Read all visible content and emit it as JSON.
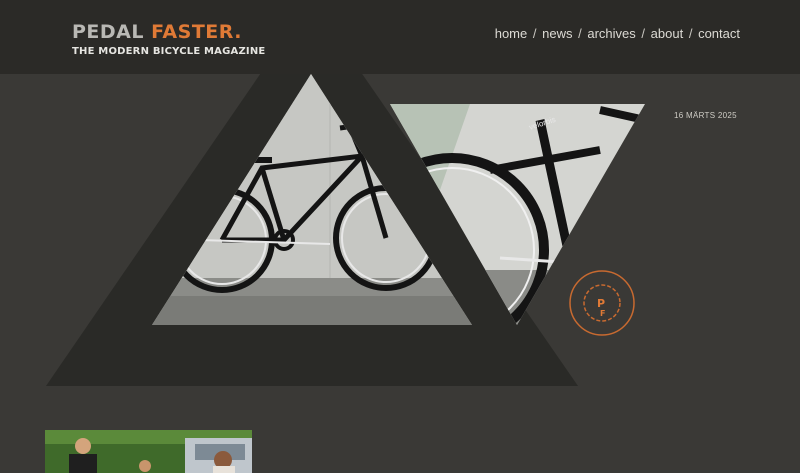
{
  "site": {
    "logo_word1": "PEDAL",
    "logo_word2": "FASTER.",
    "tagline": "THE MODERN BICYCLE MAGAZINE",
    "badge_initials": [
      "P",
      "F"
    ]
  },
  "nav": {
    "items": [
      {
        "label": "home"
      },
      {
        "label": "news"
      },
      {
        "label": "archives"
      },
      {
        "label": "about"
      },
      {
        "label": "contact"
      }
    ],
    "separator": "/"
  },
  "post": {
    "date": "16 MÄRTS 2025",
    "decal_text": "velorbis"
  },
  "colors": {
    "background": "#3a3936",
    "header": "#2b2a27",
    "accent": "#e07a36",
    "triangle": "#2a2a27"
  }
}
